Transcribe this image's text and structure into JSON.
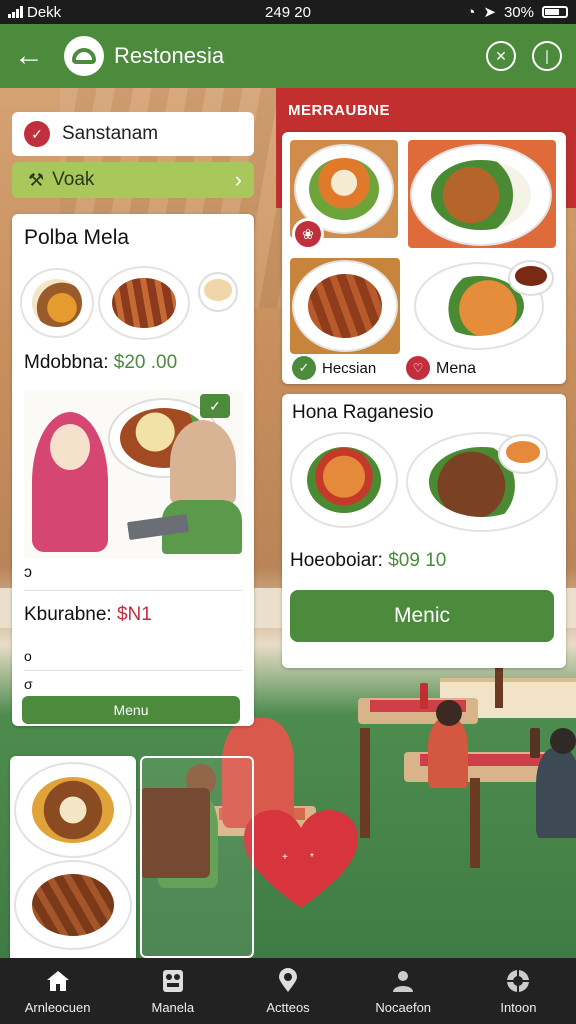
{
  "status_bar": {
    "carrier": "Dekk",
    "time": "249 20",
    "battery": "30%"
  },
  "app_bar": {
    "back_icon": "arrow-left-icon",
    "title": "Restonesia",
    "action_icons": [
      "compass-icon",
      "info-icon"
    ]
  },
  "search_chip": {
    "label": "Sanstanam"
  },
  "filter_chip": {
    "label": "Voak"
  },
  "left_card": {
    "title": "Polba Mela",
    "price_label": "Mdobbna:",
    "price_value": "$20 .00",
    "rating_marker": "ɔ",
    "sub_label": "Kburabne:",
    "sub_value": "$N1",
    "marker_a": "o",
    "marker_b": "σ",
    "button": "Menu"
  },
  "header_banner": {
    "label": "MERRAUBNE"
  },
  "top_right_card": {
    "check_label": "Hecsian",
    "menu_label": "Mena"
  },
  "right_card": {
    "title": "Hona Raganesio",
    "price_label": "Hoeoboiar:",
    "price_value": "$09 10",
    "button": "Menic"
  },
  "bottom_nav": [
    {
      "label": "Arnleocuen",
      "icon": "home-icon"
    },
    {
      "label": "Manela",
      "icon": "menu-book-icon"
    },
    {
      "label": "Actteos",
      "icon": "location-pin-icon"
    },
    {
      "label": "Nocaefon",
      "icon": "user-icon"
    },
    {
      "label": "Intoon",
      "icon": "globe-icon"
    }
  ],
  "colors": {
    "primary": "#4c8a3c",
    "accent": "#c22f2f",
    "nav_bg": "#222222"
  }
}
